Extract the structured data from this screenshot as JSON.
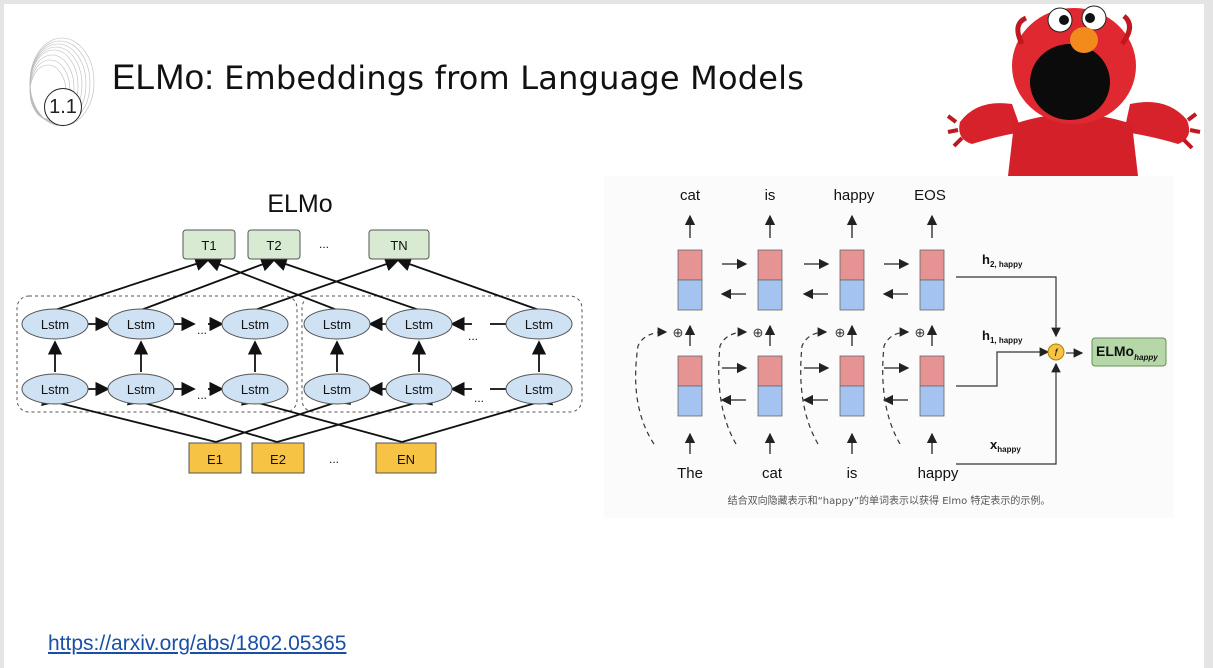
{
  "slide": {
    "badge": "1.1",
    "title_part1": "ELMo: ",
    "title_part2": "Embeddings from Language Models",
    "link": "https://arxiv.org/abs/1802.05365"
  },
  "left_diagram": {
    "heading": "ELMo",
    "outputs": [
      "T1",
      "T2",
      "...",
      "TN"
    ],
    "inputs": [
      "E1",
      "E2",
      "...",
      "EN"
    ],
    "cell_label": "Lstm",
    "ellipsis": "..."
  },
  "right_diagram": {
    "top_words": [
      "cat",
      "is",
      "happy",
      "EOS"
    ],
    "bottom_words": [
      "The",
      "cat",
      "is",
      "happy"
    ],
    "h2_label": "h",
    "h2_sub": "2, happy",
    "h1_label": "h",
    "h1_sub": "1, happy",
    "x_label": "x",
    "x_sub": "happy",
    "f_label": "f",
    "out_label": "ELMo",
    "out_sub": "happy",
    "caption": "结合双向隐藏表示和“happy”的单词表示以获得 Elmo 特定表示的示例。"
  },
  "colors": {
    "lstm_fill": "#cfe2f3",
    "output_fill": "#d9ead3",
    "input_fill": "#f6c344",
    "upper_cell": "#e69394",
    "lower_cell": "#a5c3f0",
    "link": "#1a4fa8"
  }
}
